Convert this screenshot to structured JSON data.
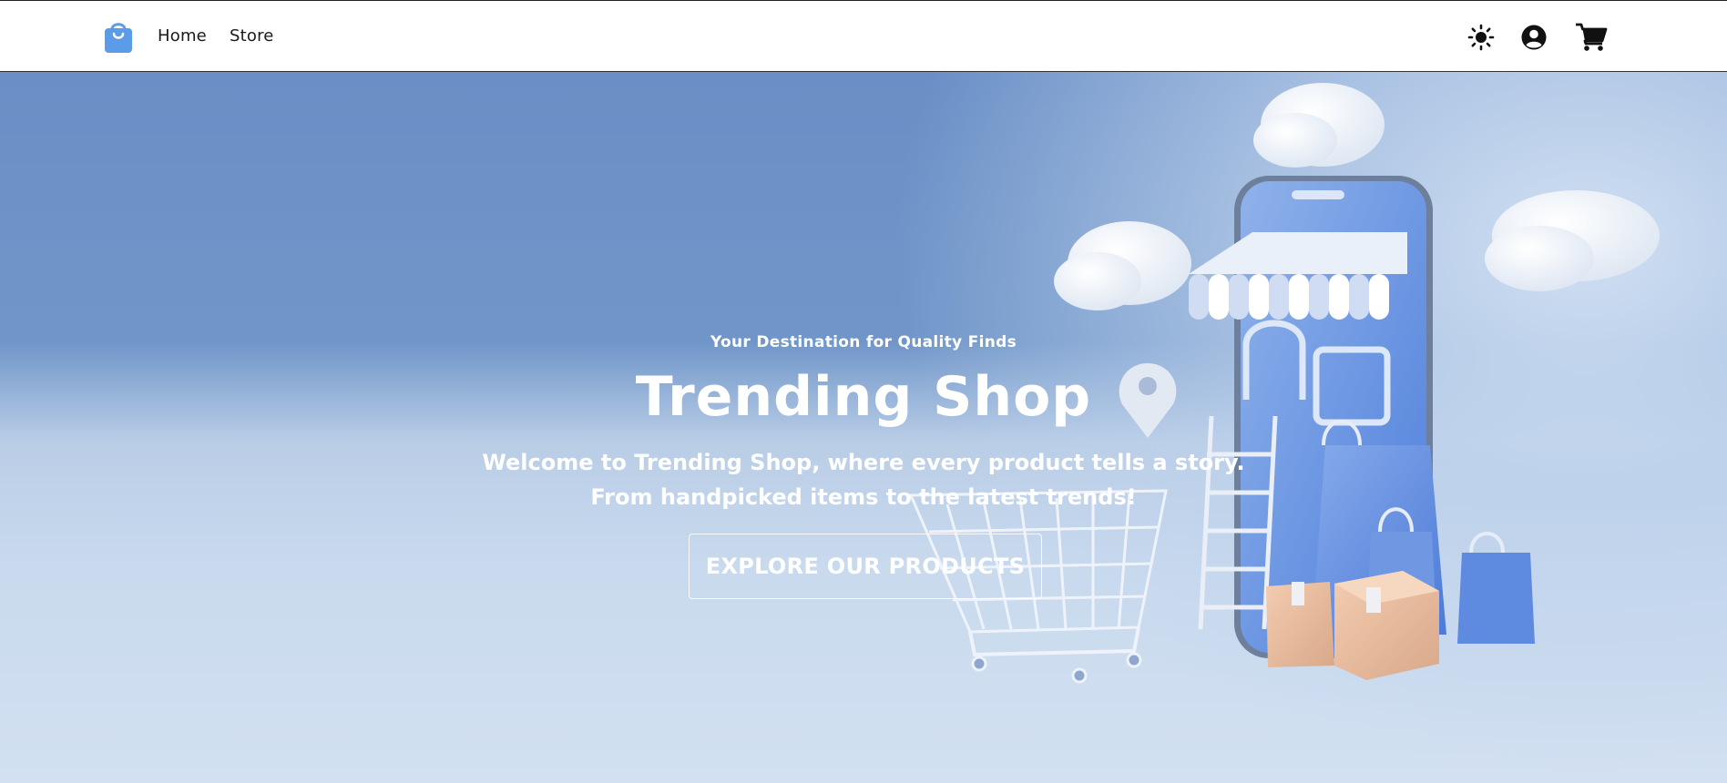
{
  "navbar": {
    "logo_icon": "shopping-bag-icon",
    "links": [
      {
        "label": "Home"
      },
      {
        "label": "Store"
      }
    ],
    "icons": {
      "theme": "sun-icon",
      "user": "user-circle-icon",
      "cart": "shopping-cart-icon"
    }
  },
  "hero": {
    "tagline": "Your Destination for Quality Finds",
    "title": "Trending Shop",
    "description_lines": [
      "Welcome to Trending Shop, where every product tells a story.",
      "From handpicked items to the latest trends!"
    ],
    "cta_label": "EXPLORE OUR PRODUCTS"
  },
  "colors": {
    "brand": "#5b9ce8",
    "hero_top": "#6a8fc6",
    "hero_bottom": "#d2e0f1",
    "text_on_hero": "#ffffff",
    "nav_text": "#1a1a1a"
  }
}
